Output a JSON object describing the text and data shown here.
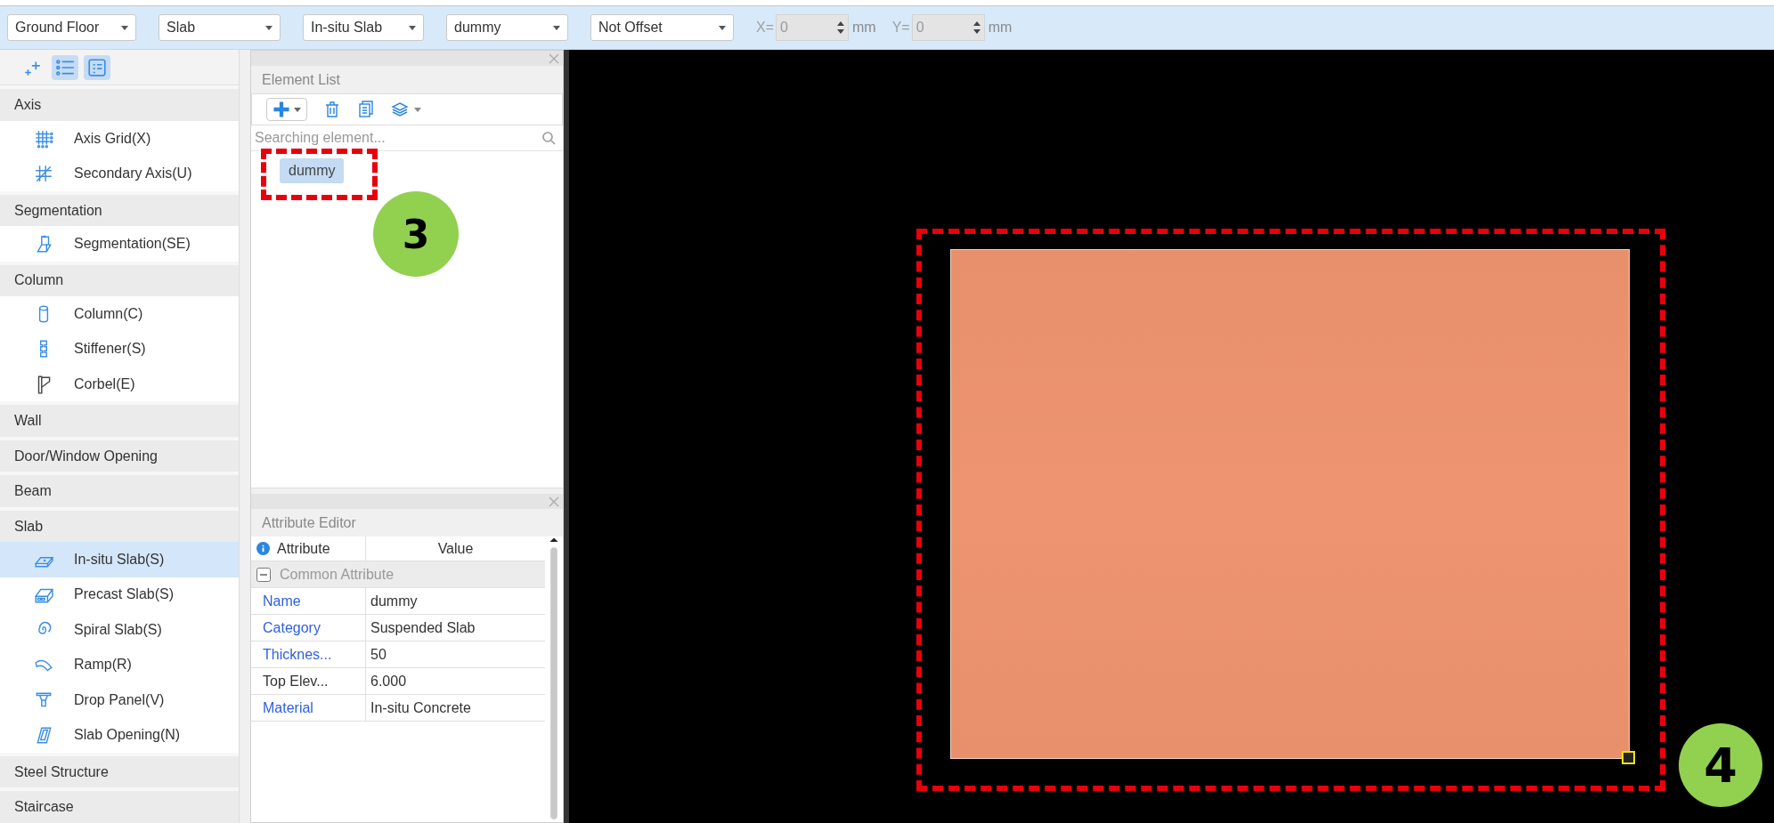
{
  "toolbar": {
    "dropdowns": [
      {
        "value": "Ground Floor"
      },
      {
        "value": "Slab"
      },
      {
        "value": "In-situ Slab"
      },
      {
        "value": "dummy"
      },
      {
        "value": "Not Offset"
      }
    ],
    "offsets": [
      {
        "label": "X=",
        "value": "0",
        "unit": "mm",
        "disabled": true
      },
      {
        "label": "Y=",
        "value": "0",
        "unit": "mm",
        "disabled": true
      }
    ]
  },
  "palette": {
    "modes": [
      {
        "kind": "add",
        "selected": false
      },
      {
        "kind": "list",
        "selected": true
      },
      {
        "kind": "detail",
        "selected": true
      }
    ],
    "sections": [
      {
        "title": "Axis",
        "items": [
          {
            "label": "Axis Grid(X)",
            "selected": false
          },
          {
            "label": "Secondary Axis(U)",
            "selected": false
          }
        ]
      },
      {
        "title": "Segmentation",
        "items": [
          {
            "label": "Segmentation(SE)",
            "selected": false
          }
        ]
      },
      {
        "title": "Column",
        "items": [
          {
            "label": "Column(C)",
            "selected": false
          },
          {
            "label": "Stiffener(S)",
            "selected": false
          },
          {
            "label": "Corbel(E)",
            "selected": false
          }
        ]
      },
      {
        "title": "Wall"
      },
      {
        "title": "Door/Window Opening"
      },
      {
        "title": "Beam"
      },
      {
        "title": "Slab",
        "items": [
          {
            "label": "In-situ Slab(S)",
            "selected": true
          },
          {
            "label": "Precast Slab(S)",
            "selected": false
          },
          {
            "label": "Spiral Slab(S)",
            "selected": false
          },
          {
            "label": "Ramp(R)",
            "selected": false
          },
          {
            "label": "Drop Panel(V)",
            "selected": false
          },
          {
            "label": "Slab Opening(N)",
            "selected": false
          }
        ]
      },
      {
        "title": "Steel Structure"
      },
      {
        "title": "Staircase"
      }
    ]
  },
  "element_list": {
    "title": "Element List",
    "search": {
      "placeholder": "Searching element..."
    },
    "items": [
      {
        "label": "dummy",
        "selected": true
      }
    ]
  },
  "attribute_editor": {
    "title": "Attribute Editor",
    "columns": [
      "Attribute",
      "Value"
    ],
    "group": {
      "title": "Common Attribute",
      "expanded": true
    },
    "rows": [
      {
        "name": "Name",
        "value": "dummy",
        "editable": true
      },
      {
        "name": "Category",
        "value": "Suspended Slab",
        "editable": true
      },
      {
        "name": "Thicknes...",
        "value": "50",
        "editable": true
      },
      {
        "name": "Top Elev...",
        "value": "6.000",
        "editable": false
      },
      {
        "name": "Material",
        "value": "In-situ Concrete",
        "editable": true
      }
    ]
  },
  "canvas": {
    "elements": [
      {
        "kind": "slab",
        "selected": true
      }
    ]
  },
  "callouts": [
    {
      "number": "3",
      "kind": "list"
    },
    {
      "number": "4",
      "kind": "canvas"
    }
  ]
}
